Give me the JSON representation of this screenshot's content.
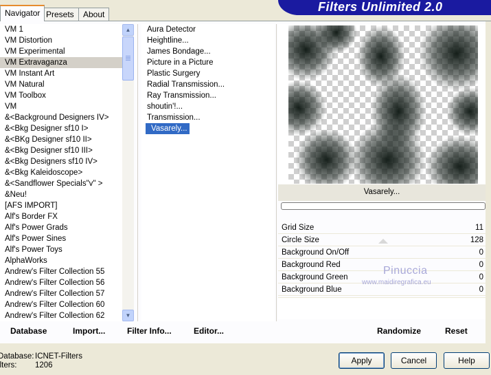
{
  "tabs": [
    "Navigator",
    "Presets",
    "About"
  ],
  "banner": "Filters Unlimited 2.0",
  "categories": [
    "VM 1",
    "VM Distortion",
    "VM Experimental",
    "VM Extravaganza",
    "VM Instant Art",
    "VM Natural",
    "VM Toolbox",
    "VM",
    "&<Background Designers IV>",
    "&<Bkg Designer sf10 I>",
    "&<BKg Designer sf10 II>",
    "&<Bkg Designer sf10 III>",
    "&<Bkg Designers sf10 IV>",
    "&<Bkg Kaleidoscope>",
    "&<Sandflower Specials\"v\" >",
    "&Neu!",
    "[AFS IMPORT]",
    "Alf's Border FX",
    "Alf's Power Grads",
    "Alf's Power Sines",
    "Alf's Power Toys",
    "AlphaWorks",
    "Andrew's Filter Collection 55",
    "Andrew's Filter Collection 56",
    "Andrew's Filter Collection 57",
    "Andrew's Filter Collection 60",
    "Andrew's Filter Collection 62"
  ],
  "selected_category": "VM Extravaganza",
  "filters": [
    "Aura Detector",
    "Heightline...",
    "James Bondage...",
    "Picture in a Picture",
    "Plastic Surgery",
    "Radial Transmission...",
    "Ray Transmission...",
    "shoutin'!...",
    "Transmission...",
    "Vasarely..."
  ],
  "selected_filter": "Vasarely...",
  "preview_filter_name": "Vasarely...",
  "params": [
    {
      "label": "Grid Size",
      "value": "11"
    },
    {
      "label": "Circle Size",
      "value": "128"
    },
    {
      "label": "Background On/Off",
      "value": "0"
    },
    {
      "label": "Background Red",
      "value": "0"
    },
    {
      "label": "Background Green",
      "value": "0"
    },
    {
      "label": "Background Blue",
      "value": "0"
    }
  ],
  "watermark": {
    "name": "Pinuccia",
    "site": "www.maidiregrafica.eu"
  },
  "panel_buttons": {
    "database": "Database",
    "import": "Import...",
    "filter_info": "Filter Info...",
    "editor": "Editor...",
    "randomize": "Randomize",
    "reset": "Reset"
  },
  "status": {
    "database_label": "Database:",
    "database_value": "ICNET-Filters",
    "filters_label": "Filters:",
    "filters_value": "1206"
  },
  "dialog_buttons": {
    "apply": "Apply",
    "cancel": "Cancel",
    "help": "Help"
  },
  "colors": {
    "banner": "#1a1aa0",
    "selection": "#316ac5",
    "accent_tab": "#e68b2c"
  }
}
